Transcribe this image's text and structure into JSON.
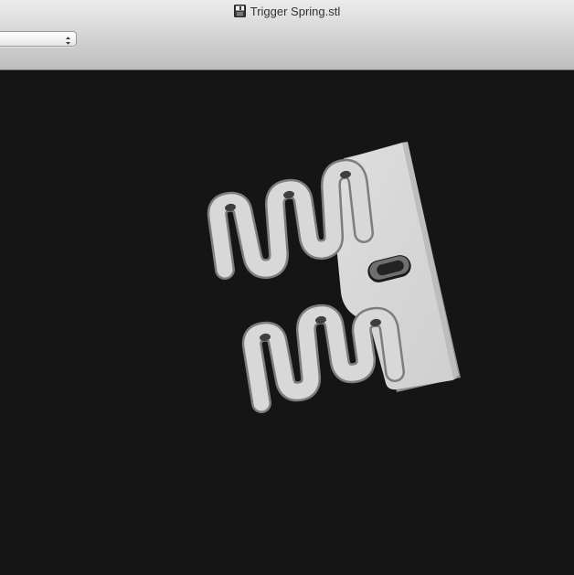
{
  "window": {
    "title": "Trigger Spring.stl",
    "title_icon": "stl-document-icon"
  },
  "toolbar": {
    "select_value": "",
    "select_icon": "updown-chevron-icon"
  },
  "viewport": {
    "background_color": "#151515",
    "model_color": "#d9d9d9",
    "model": "trigger-spring-3d-model"
  }
}
